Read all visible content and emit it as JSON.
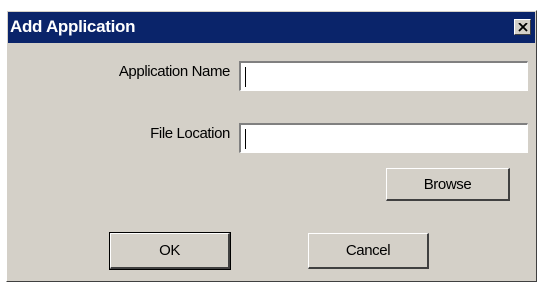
{
  "window": {
    "title": "Add Application"
  },
  "form": {
    "app_name_label": "Application Name",
    "app_name_value": "",
    "file_location_label": "File Location",
    "file_location_value": ""
  },
  "buttons": {
    "browse": "Browse",
    "ok": "OK",
    "cancel": "Cancel"
  },
  "icons": {
    "close": "close-icon"
  },
  "colors": {
    "titlebar": "#0a246a",
    "dialog_face": "#d4d0c8"
  }
}
